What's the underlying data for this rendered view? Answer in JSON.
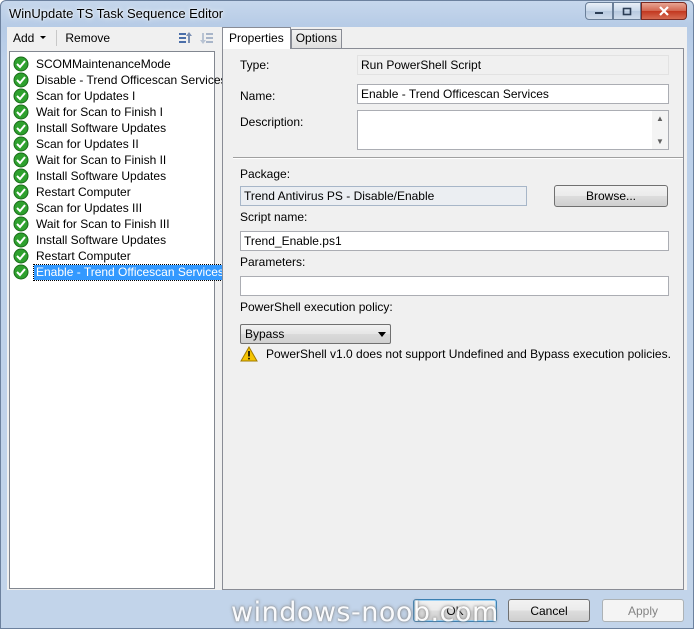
{
  "window": {
    "title": "WinUpdate TS Task Sequence Editor",
    "caption_buttons": [
      "minimize-icon",
      "maximize-icon",
      "close-icon"
    ]
  },
  "toolbar": {
    "add_label": "Add",
    "remove_label": "Remove",
    "move_up_icon": "move-up-icon",
    "move_down_icon": "move-down-icon"
  },
  "steps": [
    {
      "label": "SCOMMaintenanceMode",
      "status": "success"
    },
    {
      "label": "Disable - Trend Officescan Services",
      "status": "success"
    },
    {
      "label": "Scan for  Updates I",
      "status": "success"
    },
    {
      "label": "Wait for Scan to Finish I",
      "status": "success"
    },
    {
      "label": "Install Software Updates",
      "status": "success"
    },
    {
      "label": "Scan for  Updates II",
      "status": "success"
    },
    {
      "label": "Wait for Scan to Finish II",
      "status": "success"
    },
    {
      "label": "Install Software Updates",
      "status": "success"
    },
    {
      "label": "Restart Computer",
      "status": "success"
    },
    {
      "label": "Scan for  Updates III",
      "status": "success"
    },
    {
      "label": "Wait for Scan to Finish III",
      "status": "success"
    },
    {
      "label": "Install Software Updates",
      "status": "success"
    },
    {
      "label": "Restart Computer",
      "status": "success"
    },
    {
      "label": "Enable - Trend Officescan Services",
      "status": "success",
      "selected": true
    }
  ],
  "tabs": {
    "properties": "Properties",
    "options": "Options"
  },
  "properties": {
    "type_label": "Type:",
    "type_value": "Run PowerShell Script",
    "name_label": "Name:",
    "name_value": "Enable - Trend Officescan Services",
    "description_label": "Description:",
    "description_value": "",
    "package_label": "Package:",
    "package_value": "Trend Antivirus PS - Disable/Enable",
    "browse_label": "Browse...",
    "script_name_label": "Script name:",
    "script_name_value": "Trend_Enable.ps1",
    "parameters_label": "Parameters:",
    "parameters_value": "",
    "policy_label": "PowerShell execution policy:",
    "policy_value": "Bypass",
    "warning_text": "PowerShell v1.0 does not support Undefined and Bypass execution policies."
  },
  "buttons": {
    "ok": "OK",
    "cancel": "Cancel",
    "apply": "Apply"
  },
  "watermark": "windows-noob.com",
  "colors": {
    "selection": "#3399ff",
    "success_green": "#2ea12e",
    "warning_yellow": "#f5c400"
  }
}
